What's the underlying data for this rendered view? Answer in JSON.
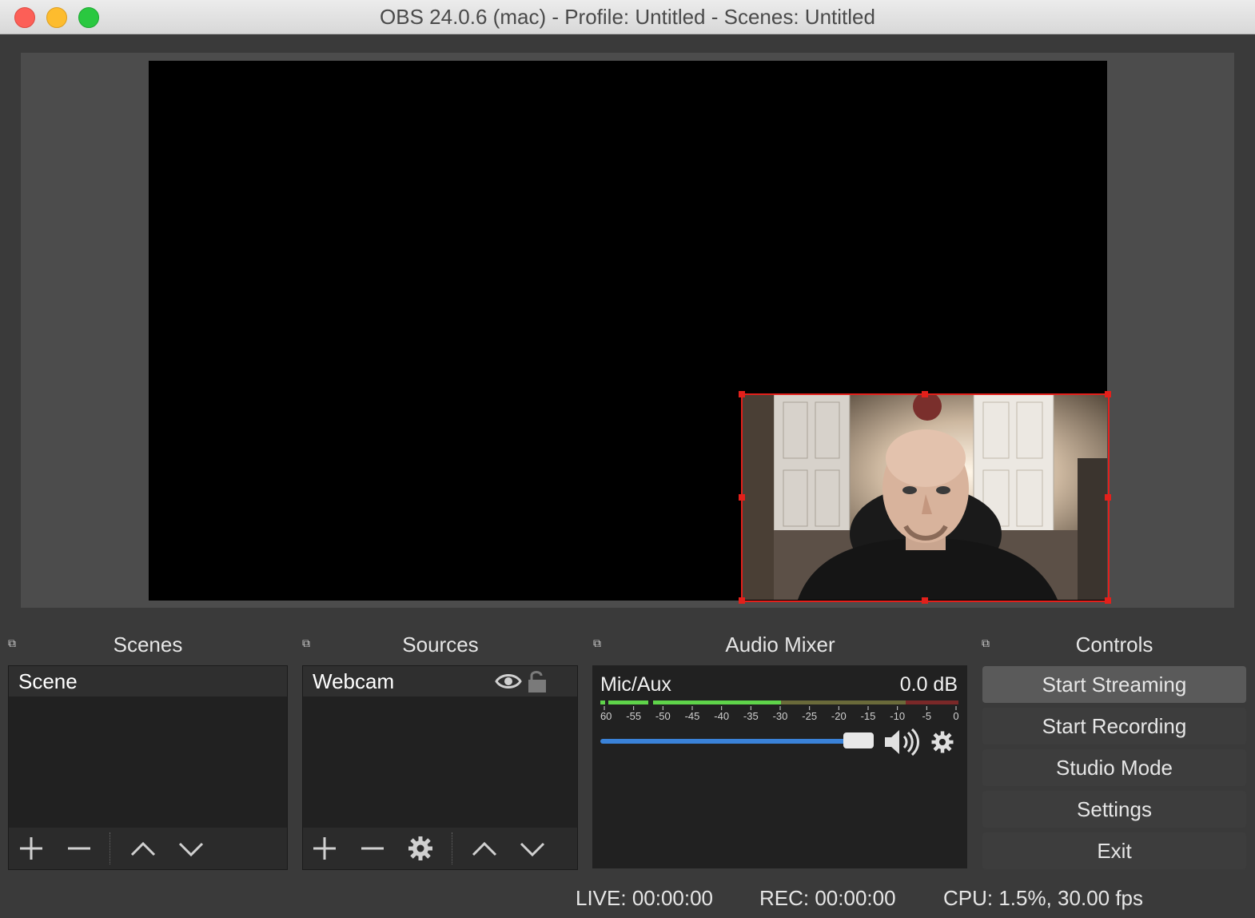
{
  "window": {
    "title": "OBS 24.0.6 (mac) - Profile: Untitled - Scenes: Untitled"
  },
  "docks": {
    "scenes": {
      "title": "Scenes",
      "items": [
        "Scene"
      ]
    },
    "sources": {
      "title": "Sources",
      "items": [
        {
          "label": "Webcam",
          "visible": true,
          "locked": false
        }
      ]
    },
    "mixer": {
      "title": "Audio Mixer",
      "channel": {
        "name": "Mic/Aux",
        "level": "0.0 dB",
        "volume_fraction": 0.95
      },
      "scale": [
        "-60",
        "-55",
        "-50",
        "-45",
        "-40",
        "-35",
        "-30",
        "-25",
        "-20",
        "-15",
        "-10",
        "-5",
        "0"
      ]
    },
    "controls": {
      "title": "Controls",
      "buttons": [
        "Start Streaming",
        "Start Recording",
        "Studio Mode",
        "Settings",
        "Exit"
      ]
    }
  },
  "status": {
    "live": "LIVE: 00:00:00",
    "rec": "REC: 00:00:00",
    "cpu": "CPU: 1.5%, 30.00 fps"
  },
  "colors": {
    "selection": "#e3201b",
    "meter_green": "#5fd44a",
    "volume_blue": "#3a82d8"
  },
  "icons": {
    "add": "plus-icon",
    "remove": "minus-icon",
    "up": "chevron-up-icon",
    "down": "chevron-down-icon",
    "gear": "gear-icon",
    "eye": "eye-icon",
    "lock": "lock-icon",
    "speaker": "speaker-icon",
    "float": "float-icon"
  }
}
